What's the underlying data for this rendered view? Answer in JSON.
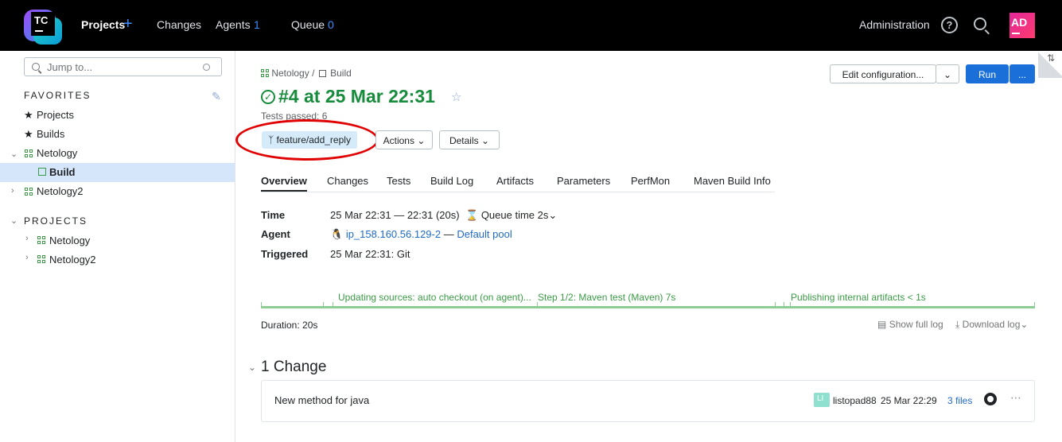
{
  "header": {
    "logo_text": "TC",
    "nav": [
      {
        "label": "Projects"
      },
      {
        "label": "Changes"
      },
      {
        "label": "Agents",
        "count": "1"
      },
      {
        "label": "Queue",
        "count": "0"
      }
    ],
    "admin_label": "Administration",
    "help_glyph": "?",
    "avatar_initials": "AD"
  },
  "sidebar": {
    "search_placeholder": "Jump to...",
    "favorites_heading": "FAVORITES",
    "favorites": [
      "Projects",
      "Builds"
    ],
    "tree": [
      {
        "label": "Netology"
      },
      {
        "label": "Build",
        "selected": true
      },
      {
        "label": "Netology2"
      }
    ],
    "projects_heading": "PROJECTS",
    "projects": [
      "Netology",
      "Netology2"
    ]
  },
  "build": {
    "breadcrumb": [
      "Netology",
      "/",
      "Build"
    ],
    "title": "#4 at 25 Mar 22:31",
    "tests_passed": "Tests passed: 6",
    "branch": "feature/add_reply",
    "actions_label": "Actions",
    "details_label": "Details",
    "edit_config_label": "Edit configuration...",
    "run_label": "Run",
    "more_label": "..."
  },
  "tabs": [
    "Overview",
    "Changes",
    "Tests",
    "Build Log",
    "Artifacts",
    "Parameters",
    "PerfMon",
    "Maven Build Info"
  ],
  "overview": {
    "time_label": "Time",
    "time_value": "25 Mar 22:31 — 22:31 (20s)",
    "queue_time": "Queue time 2s",
    "agent_label": "Agent",
    "agent_name": "ip_158.160.56.129-2",
    "agent_sep": "—",
    "agent_pool": "Default pool",
    "triggered_label": "Triggered",
    "triggered_value": "25 Mar 22:31: Git"
  },
  "timeline": {
    "stages": [
      "Updating sources: auto checkout (on agent)...",
      "Step 1/2: Maven test (Maven) 7s",
      "Publishing internal artifacts < 1s"
    ],
    "duration": "Duration: 20s",
    "show_full_log": "Show full log",
    "download_log": "Download log"
  },
  "changes": {
    "heading": "1 Change",
    "items": [
      {
        "message": "New method for java",
        "avatar": "LI",
        "user": "listopad88",
        "time": "25 Mar 22:29",
        "files": "3 files"
      }
    ]
  },
  "colors": {
    "success": "#188c3d",
    "accent": "#216bc7",
    "run_button": "#1a6fd9",
    "annotation": "#e00000"
  }
}
